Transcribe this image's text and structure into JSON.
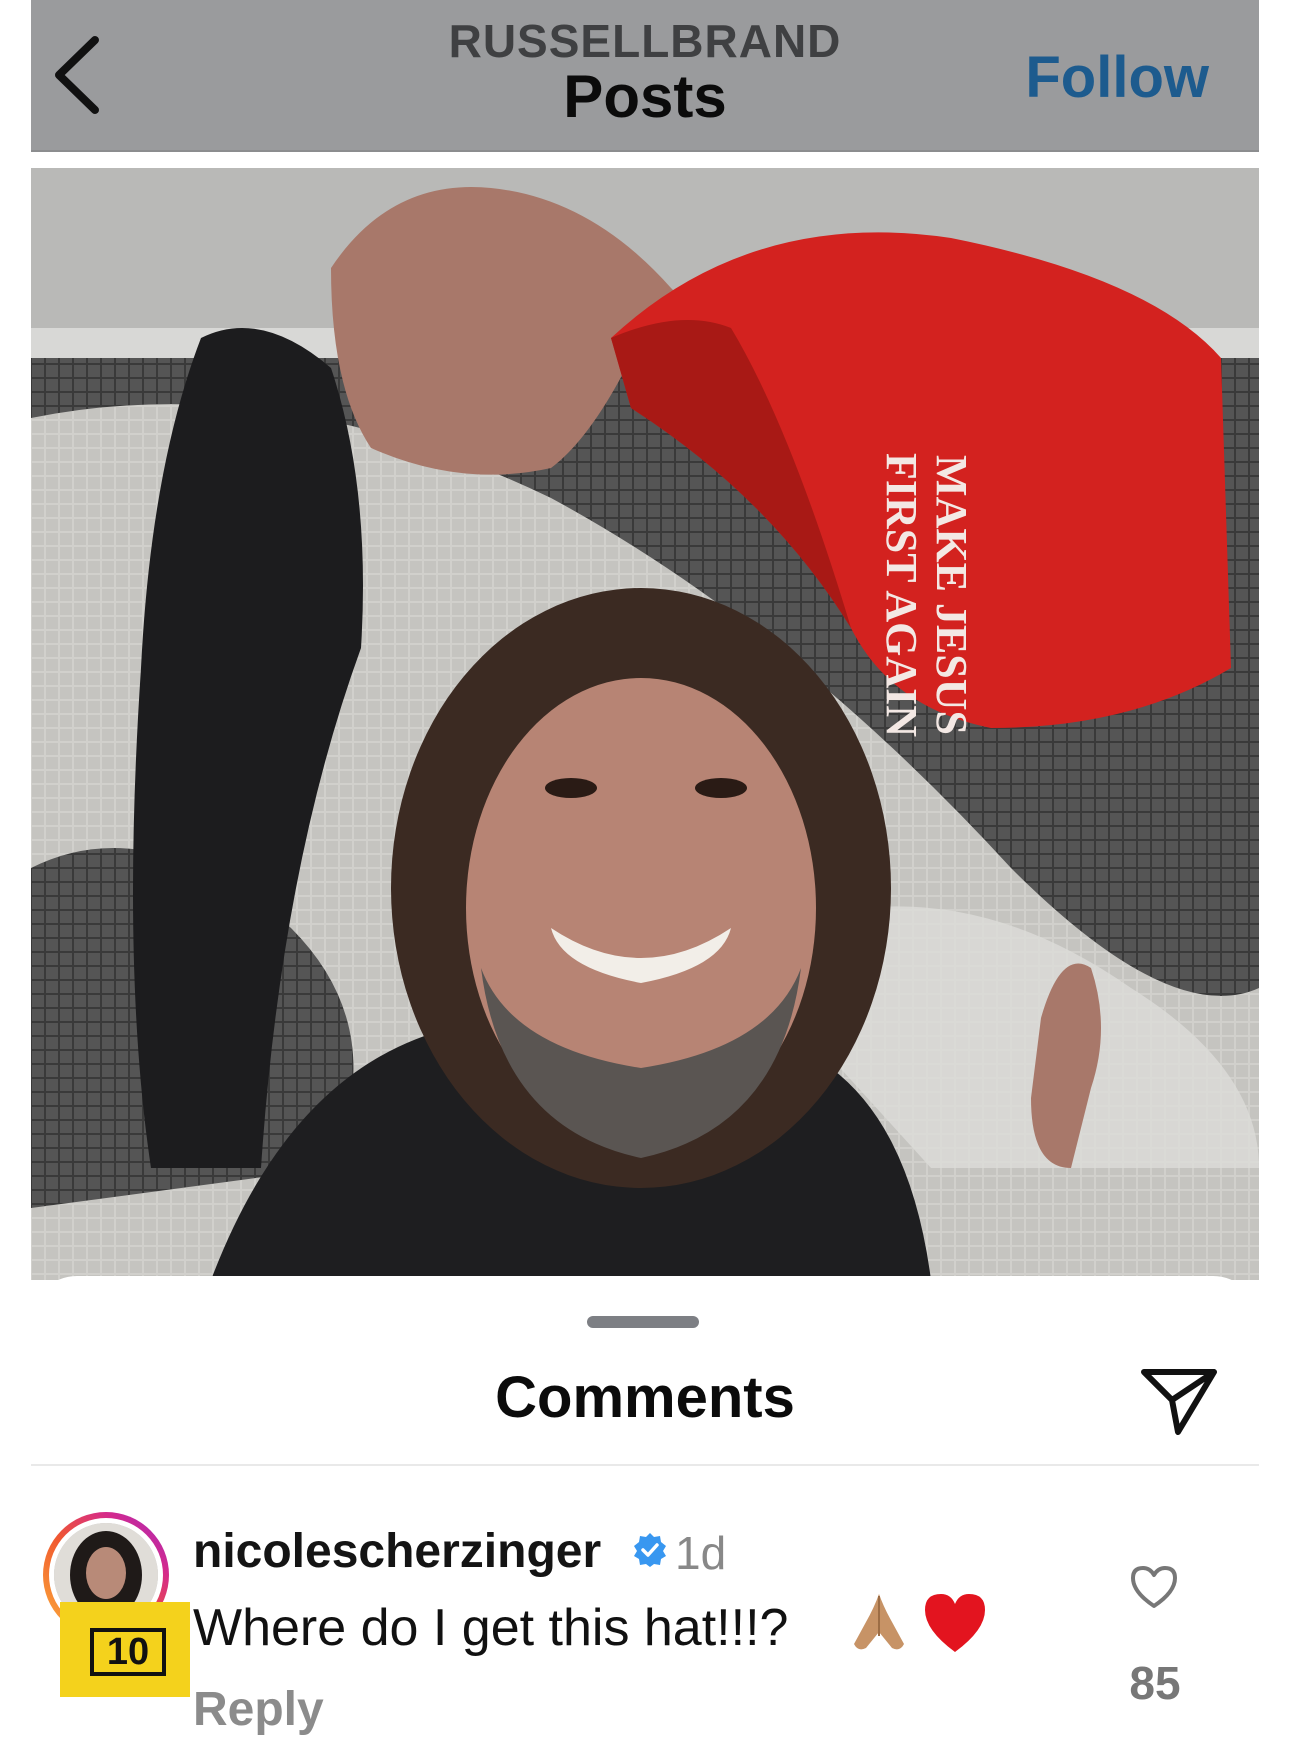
{
  "header": {
    "username": "RUSSELLBRAND",
    "title": "Posts",
    "follow_label": "Follow",
    "back_icon": "chevron-left-icon"
  },
  "post": {
    "hat_line_1": "MAKE JESUS",
    "hat_line_2": "FIRST AGAIN"
  },
  "comments_sheet": {
    "title": "Comments",
    "share_icon": "paper-plane-icon",
    "comments": [
      {
        "username": "nicolescherzinger",
        "verified": true,
        "time": "1d",
        "text": "Where do I get this hat!!!?",
        "emojis": [
          "folded-hands",
          "red-heart"
        ],
        "reply_label": "Reply",
        "likes": "85"
      }
    ]
  },
  "overlay_badge": "10",
  "colors": {
    "header_bg": "#9a9b9d",
    "follow": "#1d5b8e",
    "hat_red": "#d3221f",
    "verified_blue": "#3897f0"
  }
}
